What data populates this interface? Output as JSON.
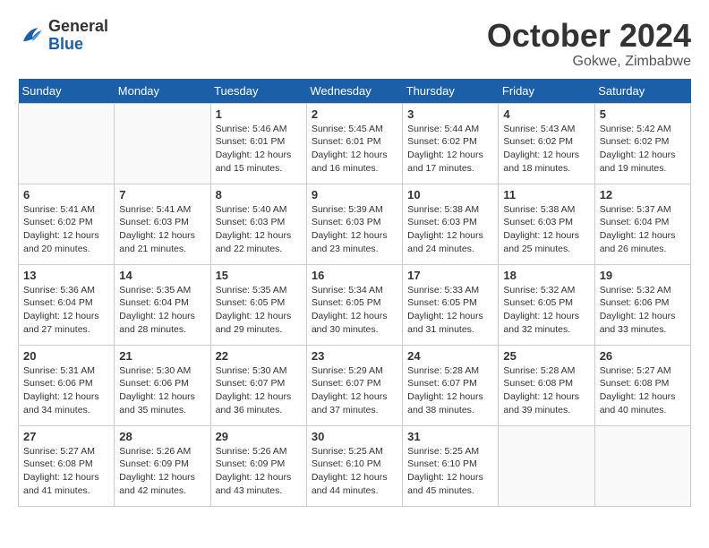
{
  "header": {
    "logo_general": "General",
    "logo_blue": "Blue",
    "month": "October 2024",
    "location": "Gokwe, Zimbabwe"
  },
  "weekdays": [
    "Sunday",
    "Monday",
    "Tuesday",
    "Wednesday",
    "Thursday",
    "Friday",
    "Saturday"
  ],
  "weeks": [
    [
      {
        "day": "",
        "info": ""
      },
      {
        "day": "",
        "info": ""
      },
      {
        "day": "1",
        "info": "Sunrise: 5:46 AM\nSunset: 6:01 PM\nDaylight: 12 hours and 15 minutes."
      },
      {
        "day": "2",
        "info": "Sunrise: 5:45 AM\nSunset: 6:01 PM\nDaylight: 12 hours and 16 minutes."
      },
      {
        "day": "3",
        "info": "Sunrise: 5:44 AM\nSunset: 6:02 PM\nDaylight: 12 hours and 17 minutes."
      },
      {
        "day": "4",
        "info": "Sunrise: 5:43 AM\nSunset: 6:02 PM\nDaylight: 12 hours and 18 minutes."
      },
      {
        "day": "5",
        "info": "Sunrise: 5:42 AM\nSunset: 6:02 PM\nDaylight: 12 hours and 19 minutes."
      }
    ],
    [
      {
        "day": "6",
        "info": "Sunrise: 5:41 AM\nSunset: 6:02 PM\nDaylight: 12 hours and 20 minutes."
      },
      {
        "day": "7",
        "info": "Sunrise: 5:41 AM\nSunset: 6:03 PM\nDaylight: 12 hours and 21 minutes."
      },
      {
        "day": "8",
        "info": "Sunrise: 5:40 AM\nSunset: 6:03 PM\nDaylight: 12 hours and 22 minutes."
      },
      {
        "day": "9",
        "info": "Sunrise: 5:39 AM\nSunset: 6:03 PM\nDaylight: 12 hours and 23 minutes."
      },
      {
        "day": "10",
        "info": "Sunrise: 5:38 AM\nSunset: 6:03 PM\nDaylight: 12 hours and 24 minutes."
      },
      {
        "day": "11",
        "info": "Sunrise: 5:38 AM\nSunset: 6:03 PM\nDaylight: 12 hours and 25 minutes."
      },
      {
        "day": "12",
        "info": "Sunrise: 5:37 AM\nSunset: 6:04 PM\nDaylight: 12 hours and 26 minutes."
      }
    ],
    [
      {
        "day": "13",
        "info": "Sunrise: 5:36 AM\nSunset: 6:04 PM\nDaylight: 12 hours and 27 minutes."
      },
      {
        "day": "14",
        "info": "Sunrise: 5:35 AM\nSunset: 6:04 PM\nDaylight: 12 hours and 28 minutes."
      },
      {
        "day": "15",
        "info": "Sunrise: 5:35 AM\nSunset: 6:05 PM\nDaylight: 12 hours and 29 minutes."
      },
      {
        "day": "16",
        "info": "Sunrise: 5:34 AM\nSunset: 6:05 PM\nDaylight: 12 hours and 30 minutes."
      },
      {
        "day": "17",
        "info": "Sunrise: 5:33 AM\nSunset: 6:05 PM\nDaylight: 12 hours and 31 minutes."
      },
      {
        "day": "18",
        "info": "Sunrise: 5:32 AM\nSunset: 6:05 PM\nDaylight: 12 hours and 32 minutes."
      },
      {
        "day": "19",
        "info": "Sunrise: 5:32 AM\nSunset: 6:06 PM\nDaylight: 12 hours and 33 minutes."
      }
    ],
    [
      {
        "day": "20",
        "info": "Sunrise: 5:31 AM\nSunset: 6:06 PM\nDaylight: 12 hours and 34 minutes."
      },
      {
        "day": "21",
        "info": "Sunrise: 5:30 AM\nSunset: 6:06 PM\nDaylight: 12 hours and 35 minutes."
      },
      {
        "day": "22",
        "info": "Sunrise: 5:30 AM\nSunset: 6:07 PM\nDaylight: 12 hours and 36 minutes."
      },
      {
        "day": "23",
        "info": "Sunrise: 5:29 AM\nSunset: 6:07 PM\nDaylight: 12 hours and 37 minutes."
      },
      {
        "day": "24",
        "info": "Sunrise: 5:28 AM\nSunset: 6:07 PM\nDaylight: 12 hours and 38 minutes."
      },
      {
        "day": "25",
        "info": "Sunrise: 5:28 AM\nSunset: 6:08 PM\nDaylight: 12 hours and 39 minutes."
      },
      {
        "day": "26",
        "info": "Sunrise: 5:27 AM\nSunset: 6:08 PM\nDaylight: 12 hours and 40 minutes."
      }
    ],
    [
      {
        "day": "27",
        "info": "Sunrise: 5:27 AM\nSunset: 6:08 PM\nDaylight: 12 hours and 41 minutes."
      },
      {
        "day": "28",
        "info": "Sunrise: 5:26 AM\nSunset: 6:09 PM\nDaylight: 12 hours and 42 minutes."
      },
      {
        "day": "29",
        "info": "Sunrise: 5:26 AM\nSunset: 6:09 PM\nDaylight: 12 hours and 43 minutes."
      },
      {
        "day": "30",
        "info": "Sunrise: 5:25 AM\nSunset: 6:10 PM\nDaylight: 12 hours and 44 minutes."
      },
      {
        "day": "31",
        "info": "Sunrise: 5:25 AM\nSunset: 6:10 PM\nDaylight: 12 hours and 45 minutes."
      },
      {
        "day": "",
        "info": ""
      },
      {
        "day": "",
        "info": ""
      }
    ]
  ]
}
